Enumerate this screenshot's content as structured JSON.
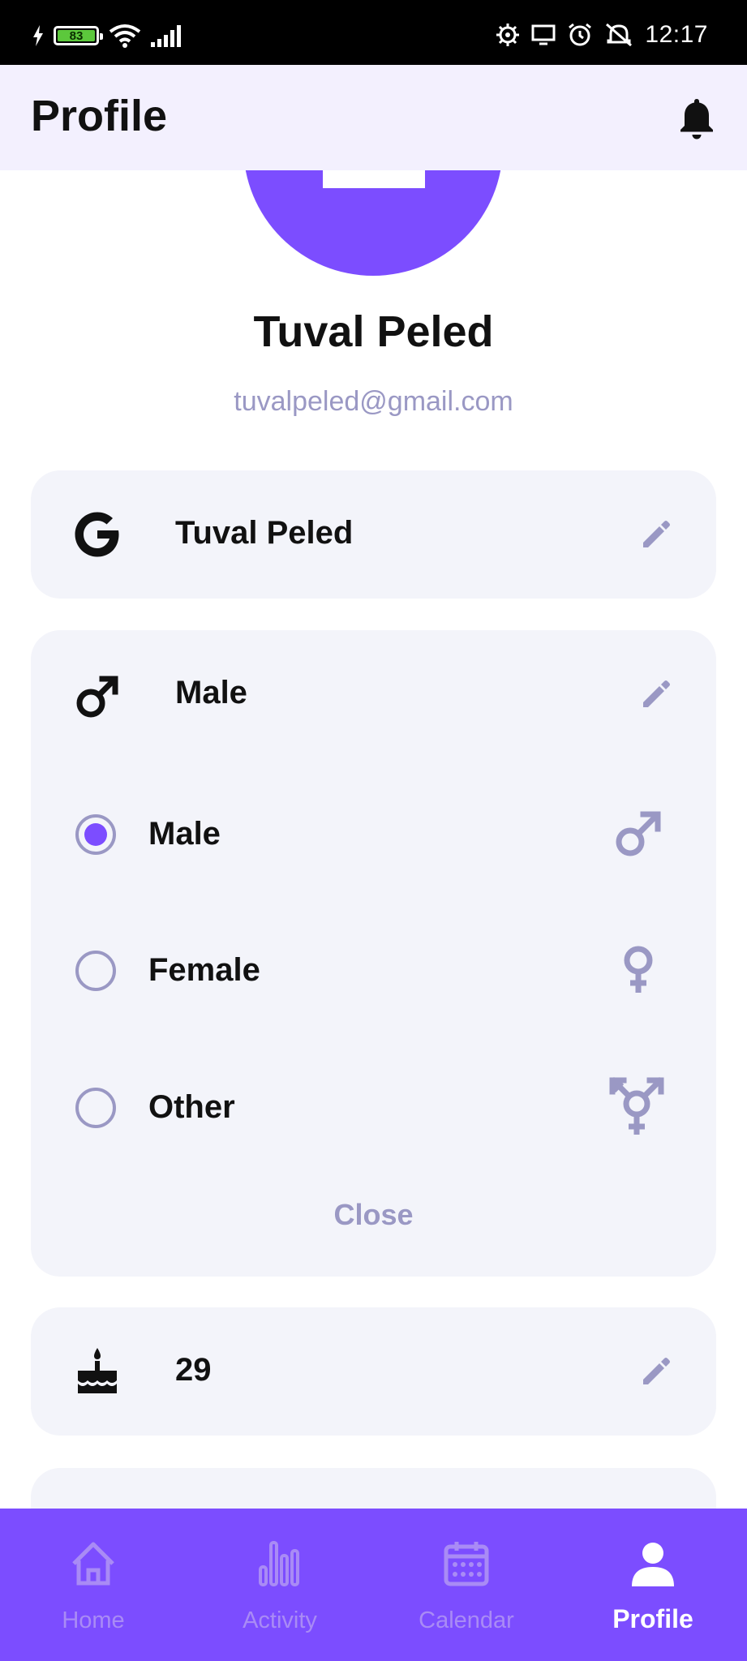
{
  "status_bar": {
    "battery_level": "83",
    "time": "12:17"
  },
  "header": {
    "title": "Profile",
    "notifications_icon": "bell-icon"
  },
  "profile": {
    "name": "Tuval Peled",
    "email": "tuvalpeled@gmail.com",
    "avatar_color": "#7c4dff"
  },
  "fields": {
    "display_name": {
      "icon": "google-icon",
      "value": "Tuval Peled"
    },
    "gender": {
      "icon": "male-icon",
      "value": "Male",
      "options": [
        {
          "label": "Male",
          "icon": "male-icon",
          "selected": true
        },
        {
          "label": "Female",
          "icon": "female-icon",
          "selected": false
        },
        {
          "label": "Other",
          "icon": "transgender-icon",
          "selected": false
        }
      ],
      "close_label": "Close"
    },
    "age": {
      "icon": "cake-icon",
      "value": "29"
    }
  },
  "bottom_nav": {
    "items": [
      {
        "label": "Home",
        "icon": "home-icon",
        "active": false
      },
      {
        "label": "Activity",
        "icon": "activity-chart-icon",
        "active": false
      },
      {
        "label": "Calendar",
        "icon": "calendar-icon",
        "active": false
      },
      {
        "label": "Profile",
        "icon": "person-icon",
        "active": true
      }
    ]
  },
  "colors": {
    "accent": "#7c4dff",
    "muted": "#9a98c4",
    "card_bg": "#f3f4fa",
    "header_bg": "#f3f0fe"
  }
}
